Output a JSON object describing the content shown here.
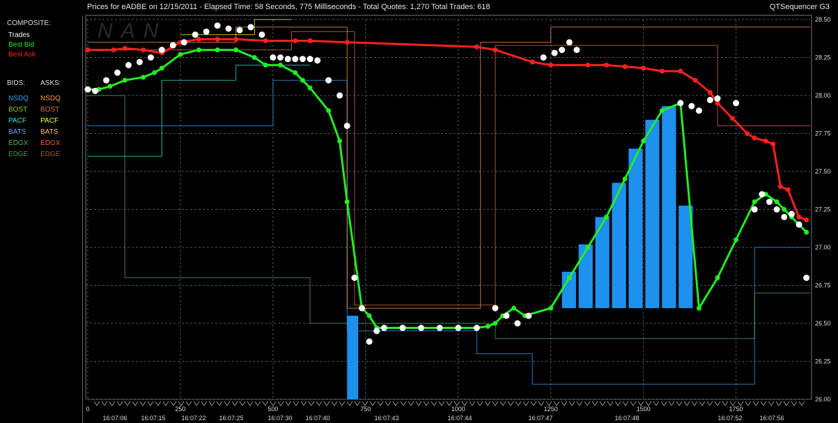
{
  "header": {
    "title": "Prices for  eADBE  on  12/15/2011  -  Elapsed Time: 58 Seconds, 775 Milliseconds  -  Total Quotes: 1,270  Total Trades: 618",
    "app_name": "QTSequencer G3"
  },
  "watermark": "NAN",
  "legend": {
    "composite_heading": "COMPOSITE:",
    "composite": [
      {
        "label": "Trades",
        "color": "#ffffff"
      },
      {
        "label": "Best Bid",
        "color": "#22ee22"
      },
      {
        "label": "Best Ask",
        "color": "#ff2020"
      }
    ],
    "bids_heading": "BIDS:",
    "asks_heading": "ASKS:",
    "exchanges": [
      {
        "bid": "NSDQ",
        "ask": "NSDQ",
        "bid_color": "#3aa0ff",
        "ask_color": "#ffa040"
      },
      {
        "bid": "BOST",
        "ask": "BOST",
        "bid_color": "#88cc44",
        "ask_color": "#e07050"
      },
      {
        "bid": "PACF",
        "ask": "PACF",
        "bid_color": "#40e0e0",
        "ask_color": "#ffff40"
      },
      {
        "bid": "BATS",
        "ask": "BATS",
        "bid_color": "#66aaff",
        "ask_color": "#ffc050"
      },
      {
        "bid": "EDGX",
        "ask": "EDGX",
        "bid_color": "#55aa55",
        "ask_color": "#cc6644"
      },
      {
        "bid": "EDGE",
        "ask": "EDGE",
        "bid_color": "#449944",
        "ask_color": "#aa5533"
      }
    ]
  },
  "chart_data": {
    "type": "line",
    "ylim": [
      26.0,
      28.5
    ],
    "xlim": [
      0,
      1950
    ],
    "y_ticks": [
      "28.50",
      "28.25",
      "28.00",
      "27.75",
      "27.50",
      "27.25",
      "27.00",
      "26.75",
      "26.50",
      "26.25",
      "26.00"
    ],
    "x_ticks": [
      "0",
      "250",
      "500",
      "750",
      "1000",
      "1250",
      "1500",
      "1750"
    ],
    "time_labels": [
      "16:07:06",
      "16:07:15",
      "16:07:22",
      "16:07:25",
      "16:07:30",
      "16:07:40",
      "16:07:43",
      "16:07:44",
      "16:07:47",
      "16:07:48",
      "16:07:52",
      "16:07:56"
    ],
    "grid": true,
    "series": [
      {
        "name": "Best Ask",
        "color": "#ff2020",
        "x": [
          0,
          70,
          100,
          150,
          200,
          250,
          300,
          350,
          400,
          480,
          560,
          600,
          700,
          1050,
          1100,
          1200,
          1250,
          1350,
          1400,
          1450,
          1500,
          1550,
          1600,
          1640,
          1680,
          1700,
          1740,
          1780,
          1800,
          1830,
          1850,
          1870,
          1890,
          1920,
          1940
        ],
        "y": [
          28.3,
          28.3,
          28.31,
          28.3,
          28.28,
          28.35,
          28.37,
          28.37,
          28.37,
          28.36,
          28.36,
          28.36,
          28.35,
          28.32,
          28.3,
          28.22,
          28.2,
          28.2,
          28.2,
          28.19,
          28.18,
          28.16,
          28.16,
          28.1,
          28.02,
          27.95,
          27.85,
          27.75,
          27.72,
          27.7,
          27.68,
          27.4,
          27.38,
          27.2,
          27.18
        ]
      },
      {
        "name": "Best Bid",
        "color": "#22ee22",
        "x": [
          0,
          30,
          60,
          100,
          150,
          180,
          200,
          250,
          300,
          350,
          400,
          450,
          480,
          520,
          560,
          580,
          600,
          650,
          680,
          700,
          740,
          760,
          780,
          800,
          850,
          900,
          950,
          1000,
          1050,
          1080,
          1100,
          1120,
          1150,
          1180,
          1250,
          1300,
          1350,
          1400,
          1450,
          1500,
          1550,
          1600,
          1650,
          1700,
          1750,
          1800,
          1830,
          1860,
          1880,
          1900,
          1920,
          1940
        ],
        "y": [
          28.04,
          28.04,
          28.06,
          28.1,
          28.12,
          28.15,
          28.18,
          28.27,
          28.3,
          28.3,
          28.3,
          28.25,
          28.2,
          28.2,
          28.15,
          28.1,
          28.05,
          27.9,
          27.7,
          27.3,
          26.6,
          26.55,
          26.47,
          26.47,
          26.47,
          26.47,
          26.47,
          26.47,
          26.47,
          26.48,
          26.5,
          26.55,
          26.6,
          26.55,
          26.6,
          26.8,
          27.0,
          27.2,
          27.45,
          27.7,
          27.9,
          27.95,
          26.6,
          26.8,
          27.05,
          27.3,
          27.35,
          27.3,
          27.25,
          27.2,
          27.15,
          27.1
        ]
      },
      {
        "name": "Trades",
        "color": "#ffffff",
        "x": [
          0,
          20,
          50,
          80,
          110,
          140,
          170,
          200,
          230,
          260,
          290,
          320,
          350,
          380,
          410,
          440,
          470,
          500,
          520,
          540,
          560,
          580,
          600,
          620,
          650,
          680,
          700,
          720,
          740,
          760,
          780,
          800,
          850,
          900,
          950,
          1000,
          1050,
          1100,
          1130,
          1160,
          1190,
          1230,
          1260,
          1280,
          1300,
          1320,
          1600,
          1630,
          1650,
          1680,
          1700,
          1750,
          1800,
          1820,
          1840,
          1860,
          1880,
          1900,
          1920,
          1940
        ],
        "y": [
          28.04,
          28.03,
          28.1,
          28.15,
          28.2,
          28.22,
          28.25,
          28.3,
          28.33,
          28.35,
          28.4,
          28.42,
          28.46,
          28.44,
          28.43,
          28.45,
          28.4,
          28.25,
          28.25,
          28.24,
          28.24,
          28.24,
          28.24,
          28.23,
          28.1,
          28.0,
          27.8,
          26.8,
          26.6,
          26.38,
          26.45,
          26.47,
          26.47,
          26.47,
          26.47,
          26.47,
          26.47,
          26.6,
          26.55,
          26.5,
          26.55,
          28.25,
          28.28,
          28.3,
          28.35,
          28.3,
          27.95,
          27.93,
          27.9,
          27.97,
          27.98,
          27.95,
          27.25,
          27.35,
          27.3,
          27.25,
          27.2,
          27.22,
          27.15,
          26.8
        ]
      }
    ]
  }
}
